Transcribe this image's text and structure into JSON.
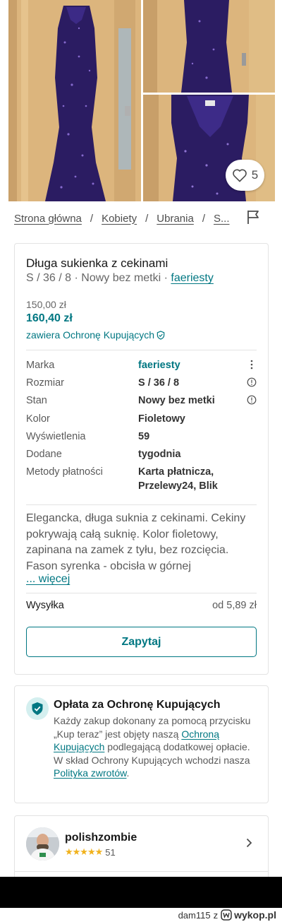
{
  "gallery": {
    "favorites_count": "5"
  },
  "breadcrumb": {
    "items": [
      "Strona główna",
      "Kobiety",
      "Ubrania",
      "S..."
    ],
    "separator": "/"
  },
  "item": {
    "title": "Długa sukienka z cekinami",
    "subtitle_prefix": "S / 36 / 8 · Nowy bez metki · ",
    "brand": "faeriesty",
    "price": "150,00 zł",
    "price_with_protection": "160,40 zł",
    "protection_note": "zawiera Ochronę Kupujących",
    "details": [
      {
        "label": "Marka",
        "value": "faeriesty"
      },
      {
        "label": "Rozmiar",
        "value": "S / 36 / 8"
      },
      {
        "label": "Stan",
        "value": "Nowy bez metki"
      },
      {
        "label": "Kolor",
        "value": "Fioletowy"
      },
      {
        "label": "Wyświetlenia",
        "value": "59"
      },
      {
        "label": "Dodane",
        "value": "tygodnia"
      },
      {
        "label": "Metody płatności",
        "value": "Karta płatnicza, Przelewy24, Blik"
      }
    ],
    "description": "Elegancka, długa suknia z cekinami. Cekiny pokrywają całą suknię. Kolor fioletowy, zapinana na zamek z tyłu, bez rozcięcia. Fason syrenka - obcisła w górnej",
    "more_link": "... więcej",
    "shipping_label": "Wysyłka",
    "shipping_value": "od 5,89 zł",
    "ask_button": "Zapytaj"
  },
  "buyer_protection": {
    "title": "Opłata za Ochronę Kupujących",
    "text_1": "Każdy zakup dokonany za pomocą przycisku „Kup teraz” jest objęty naszą ",
    "link_1": "Ochroną Kupujących",
    "text_2": " podlegającą dodatkowej opłacie. W skład Ochrony Kupujących wchodzi nasza ",
    "link_2": "Polityka zwrotów",
    "text_3": "."
  },
  "seller": {
    "name": "polishzombie",
    "stars": "★★★★★",
    "review_count": "51"
  },
  "watermark": {
    "user": "dam115",
    "connector": "z",
    "site": "wykop.pl"
  },
  "colors": {
    "accent": "#007782",
    "dress": "#2a1a5e",
    "door": "#d9b27c"
  }
}
